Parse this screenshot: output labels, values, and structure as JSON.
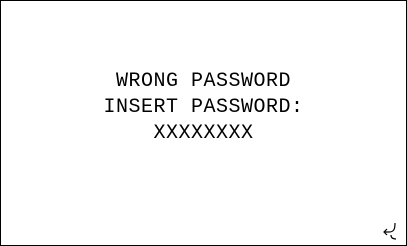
{
  "screen": {
    "lines": [
      "WRONG PASSWORD",
      "INSERT PASSWORD:",
      "XXXXXXXX"
    ]
  },
  "icons": {
    "corner": "enter-key-icon"
  },
  "colors": {
    "background": "#ffffff",
    "text": "#000000",
    "border": "#000000"
  }
}
